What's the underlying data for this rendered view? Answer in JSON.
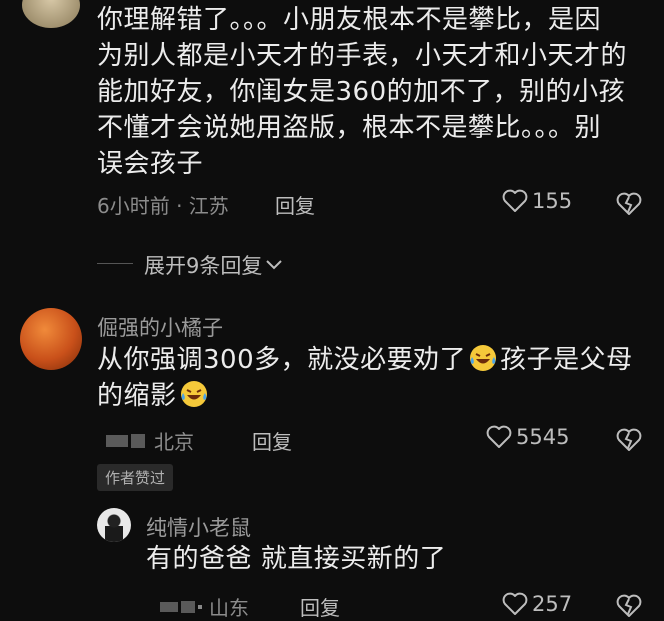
{
  "comments": [
    {
      "text": "你理解错了。。。小朋友根本不是攀比，是因为别人都是小天才的手表，小天才和小天才的能加好友，你闺女是360的加不了，别的小孩不懂才会说她用盗版，根本不是攀比。。。别误会孩子",
      "lines": [
        "你理解错了。。。小朋友根本不是攀比，是因",
        "为别人都是小天才的手表，小天才和小天才的",
        "能加好友，你闺女是360的加不了，别的小孩",
        "不懂才会说她用盗版，根本不是攀比。。。别",
        "误会孩子"
      ],
      "meta": "6小时前 · 江苏",
      "reply_label": "回复",
      "likes": "155"
    },
    {
      "username": "倔强的小橘子",
      "line1": "从你强调300多，就没必要劝了",
      "line1_tail": "孩子是父母",
      "line2": "的缩影",
      "location": "北京",
      "reply_label": "回复",
      "likes": "5545",
      "author_tag": "作者赞过"
    }
  ],
  "expand_label": "展开9条回复",
  "reply": {
    "username": "纯情小老鼠",
    "text": "有的爸爸 就直接买新的了",
    "location": "山东",
    "reply_label": "回复",
    "likes": "257"
  },
  "icons": [
    "heart-icon",
    "broken-heart-icon",
    "chevron-down-icon",
    "laughing-crying-emoji"
  ]
}
